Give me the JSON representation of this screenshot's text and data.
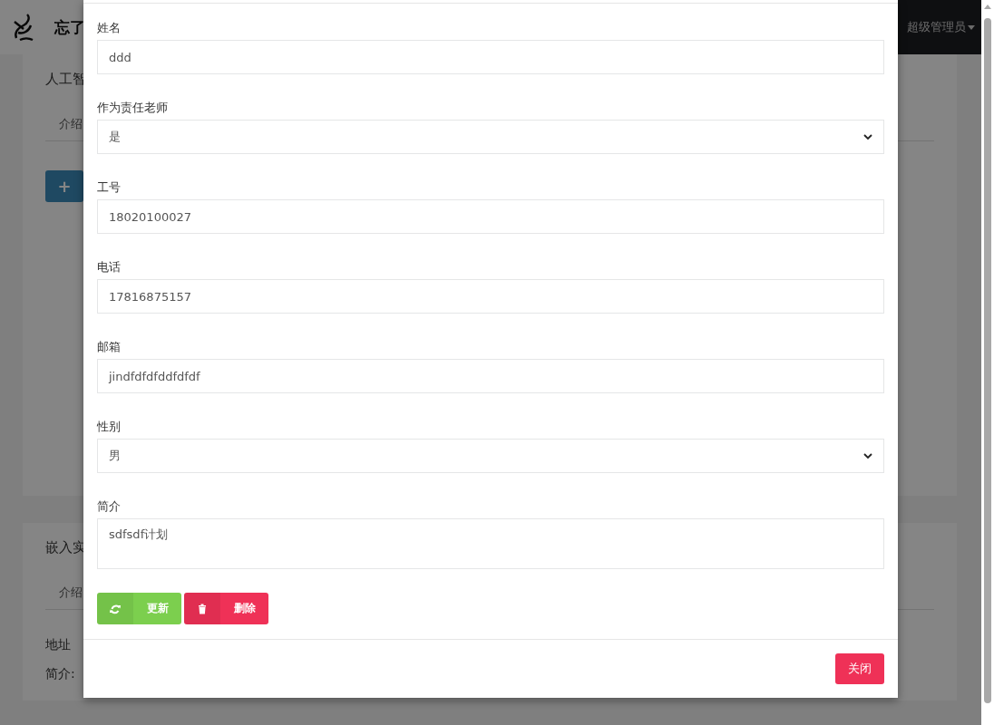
{
  "header": {
    "title": "忘了",
    "user": "超级管理员"
  },
  "cards": [
    {
      "title": "人工智",
      "tab": "介绍",
      "add_button": "+"
    },
    {
      "title": "嵌入实",
      "tab": "介绍",
      "lines": [
        "地址",
        "简介:"
      ]
    }
  ],
  "modal": {
    "fields": [
      {
        "kind": "text",
        "label": "姓名",
        "value": "ddd"
      },
      {
        "kind": "select",
        "label": "作为责任老师",
        "value": "是"
      },
      {
        "kind": "text",
        "label": "工号",
        "value": "18020100027"
      },
      {
        "kind": "text",
        "label": "电话",
        "value": "17816875157"
      },
      {
        "kind": "text",
        "label": "邮箱",
        "value": "jindfdfdfddfdfdf"
      },
      {
        "kind": "select",
        "label": "性别",
        "value": "男"
      },
      {
        "kind": "textarea",
        "label": "简介",
        "value": "sdfsdf计划"
      }
    ],
    "buttons": [
      {
        "kind": "update",
        "label": "更新"
      },
      {
        "kind": "delete",
        "label": "删除"
      }
    ],
    "close": "关闭"
  }
}
